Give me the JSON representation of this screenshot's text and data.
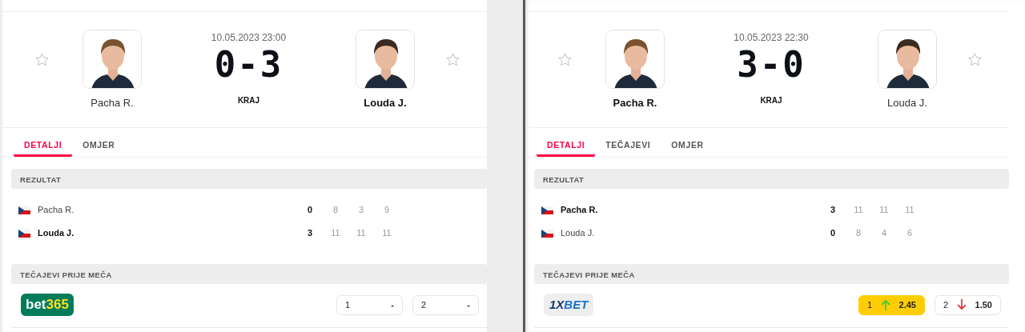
{
  "panels": [
    {
      "date": "10.05.2023 23:00",
      "score": "0-3",
      "status": "KRAJ",
      "players": [
        {
          "name": "Pacha R.",
          "winner": false
        },
        {
          "name": "Louda J.",
          "winner": true
        }
      ],
      "tabs": [
        {
          "label": "DETALJI",
          "selected": true
        },
        {
          "label": "OMJER",
          "selected": false
        }
      ],
      "result": {
        "title": "REZULTAT",
        "rows": [
          {
            "player": "Pacha R.",
            "winner": false,
            "sets": "0",
            "points": [
              "8",
              "3",
              "9"
            ]
          },
          {
            "player": "Louda J.",
            "winner": true,
            "sets": "3",
            "points": [
              "11",
              "11",
              "11"
            ]
          }
        ]
      },
      "odds": {
        "title": "TEČAJEVI PRIJE MEČA",
        "logo": {
          "kind": "bet365",
          "main": "bet",
          "accent": "365"
        },
        "options": [
          {
            "label": "1",
            "value": "-",
            "rising": false,
            "falling": false,
            "highlighted": false
          },
          {
            "label": "2",
            "value": "-",
            "rising": false,
            "falling": false,
            "highlighted": false
          }
        ]
      }
    },
    {
      "date": "10.05.2023 22:30",
      "score": "3-0",
      "status": "KRAJ",
      "players": [
        {
          "name": "Pacha R.",
          "winner": true
        },
        {
          "name": "Louda J.",
          "winner": false
        }
      ],
      "tabs": [
        {
          "label": "DETALJI",
          "selected": true
        },
        {
          "label": "TEČAJEVI",
          "selected": false
        },
        {
          "label": "OMJER",
          "selected": false
        }
      ],
      "result": {
        "title": "REZULTAT",
        "rows": [
          {
            "player": "Pacha R.",
            "winner": true,
            "sets": "3",
            "points": [
              "11",
              "11",
              "11"
            ]
          },
          {
            "player": "Louda J.",
            "winner": false,
            "sets": "0",
            "points": [
              "8",
              "4",
              "6"
            ]
          }
        ]
      },
      "odds": {
        "title": "TEČAJEVI PRIJE MEČA",
        "logo": {
          "kind": "onexbet",
          "main": "1X",
          "accent": "BET"
        },
        "options": [
          {
            "label": "1",
            "value": "2.45",
            "rising": true,
            "falling": false,
            "highlighted": true
          },
          {
            "label": "2",
            "value": "1.50",
            "rising": false,
            "falling": true,
            "highlighted": false
          }
        ]
      }
    }
  ]
}
